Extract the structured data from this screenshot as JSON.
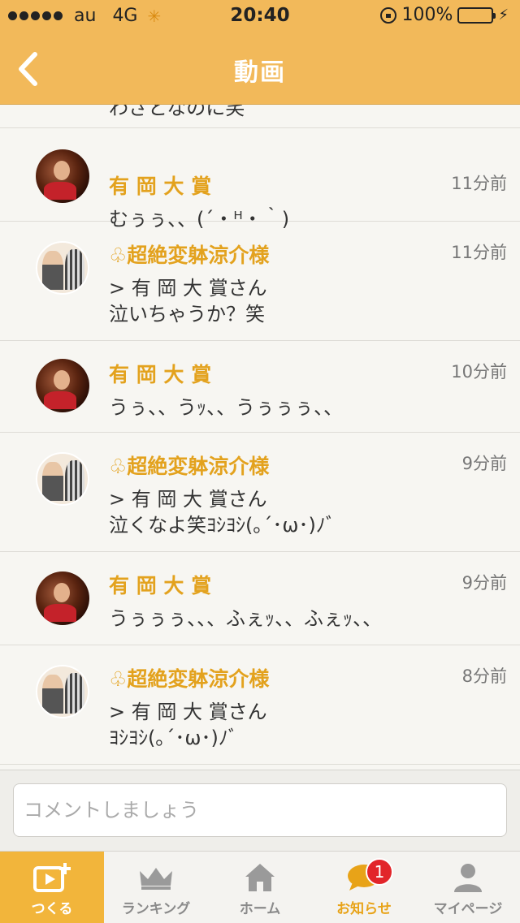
{
  "status_bar": {
    "carrier": "au",
    "network": "4G",
    "time": "20:40",
    "battery": "100%"
  },
  "header": {
    "title": "動画"
  },
  "cut_off_comment": "わざとなのに笑",
  "comments": [
    {
      "name": "有 岡 大 賞",
      "time": "11分前",
      "lines": [
        "むぅぅ、、(´・ᴴ・｀)"
      ],
      "avatar": "a"
    },
    {
      "name": "♧超絶変躰涼介様",
      "time": "11分前",
      "lines": [
        "> 有 岡 大 賞さん",
        "泣いちゃうか？笑"
      ],
      "avatar": "b"
    },
    {
      "name": "有 岡 大 賞",
      "time": "10分前",
      "lines": [
        "うぅ、、うｯ、、うぅぅぅ、、"
      ],
      "avatar": "a"
    },
    {
      "name": "♧超絶変躰涼介様",
      "time": "9分前",
      "lines": [
        "> 有 岡 大 賞さん",
        "泣くなよ笑ﾖｼﾖｼ(｡´･ω･)ﾉﾞ"
      ],
      "avatar": "b"
    },
    {
      "name": "有 岡 大 賞",
      "time": "9分前",
      "lines": [
        "うぅぅぅ、、、ふぇｯ、、ふぇｯ、、"
      ],
      "avatar": "a"
    },
    {
      "name": "♧超絶変躰涼介様",
      "time": "8分前",
      "lines": [
        "> 有 岡 大 賞さん",
        "ﾖｼﾖｼ(｡´･ω･)ﾉﾞ"
      ],
      "avatar": "b"
    }
  ],
  "comment_input": {
    "placeholder": "コメントしましょう"
  },
  "tabs": [
    {
      "label": "つくる",
      "icon": "create-video-icon"
    },
    {
      "label": "ランキング",
      "icon": "crown-icon"
    },
    {
      "label": "ホーム",
      "icon": "home-icon"
    },
    {
      "label": "お知らせ",
      "icon": "speech-bubble-icon",
      "badge": "1"
    },
    {
      "label": "マイページ",
      "icon": "person-icon"
    }
  ],
  "colors": {
    "header": "#f2b95a",
    "accent": "#e3a21e",
    "active_tab": "#f2b53b",
    "badge": "#e2252a"
  }
}
